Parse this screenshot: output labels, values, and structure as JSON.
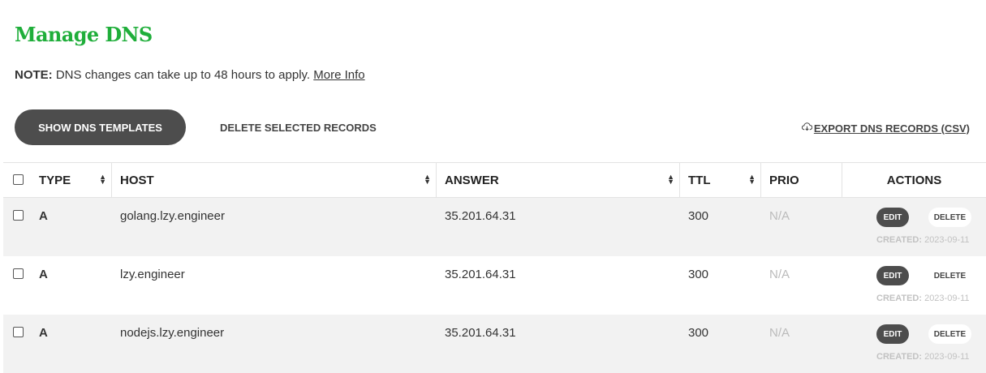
{
  "page": {
    "title": "Manage DNS",
    "note_label": "NOTE:",
    "note_text": " DNS changes can take up to 48 hours to apply. ",
    "more_info": "More Info"
  },
  "toolbar": {
    "show_templates": "SHOW DNS TEMPLATES",
    "delete_selected": "DELETE SELECTED RECORDS",
    "export": " EXPORT DNS RECORDS (CSV)"
  },
  "table": {
    "headers": {
      "type": "TYPE",
      "host": "HOST",
      "answer": "ANSWER",
      "ttl": "TTL",
      "prio": "PRIO",
      "actions": "ACTIONS"
    },
    "rows": [
      {
        "type": "A",
        "host": "golang.lzy.engineer",
        "answer": "35.201.64.31",
        "ttl": "300",
        "prio": "N/A",
        "edit": "EDIT",
        "delete": "DELETE",
        "created_label": "CREATED:",
        "created_date": " 2023-09-11"
      },
      {
        "type": "A",
        "host": "lzy.engineer",
        "answer": "35.201.64.31",
        "ttl": "300",
        "prio": "N/A",
        "edit": "EDIT",
        "delete": "DELETE",
        "created_label": "CREATED:",
        "created_date": " 2023-09-11"
      },
      {
        "type": "A",
        "host": "nodejs.lzy.engineer",
        "answer": "35.201.64.31",
        "ttl": "300",
        "prio": "N/A",
        "edit": "EDIT",
        "delete": "DELETE",
        "created_label": "CREATED:",
        "created_date": " 2023-09-11"
      }
    ]
  },
  "colors": {
    "title_green": "#1fae3a",
    "dark_button": "#4d4d4d",
    "alt_row": "#f2f2f2"
  }
}
